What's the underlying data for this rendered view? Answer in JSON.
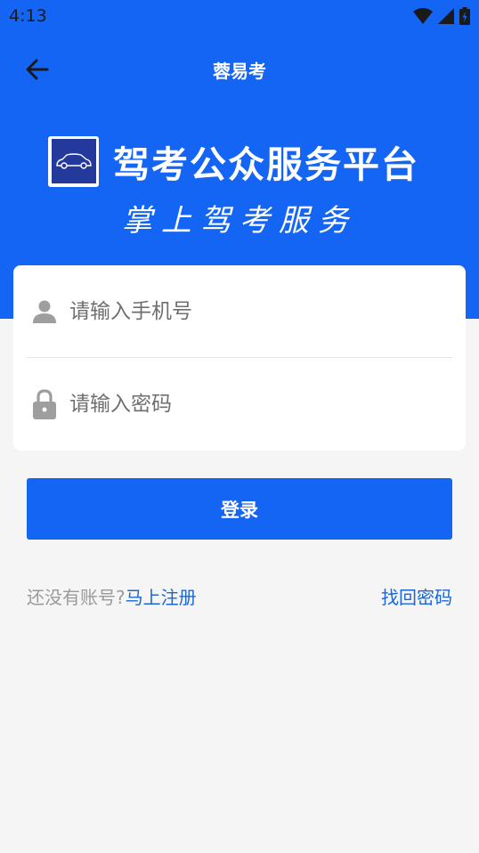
{
  "status_bar": {
    "time": "4:13"
  },
  "app_bar": {
    "title": "蓉易考"
  },
  "banner": {
    "logo_title": "驾考公众服务平台",
    "slogan": "掌上驾考服务"
  },
  "form": {
    "phone_placeholder": "请输入手机号",
    "password_placeholder": "请输入密码",
    "login_label": "登录"
  },
  "footer": {
    "no_account_text": "还没有账号?",
    "register_label": "马上注册",
    "forgot_label": "找回密码"
  },
  "colors": {
    "primary": "#1565f5",
    "link": "#1a66d8",
    "background": "#f5f5f5"
  }
}
